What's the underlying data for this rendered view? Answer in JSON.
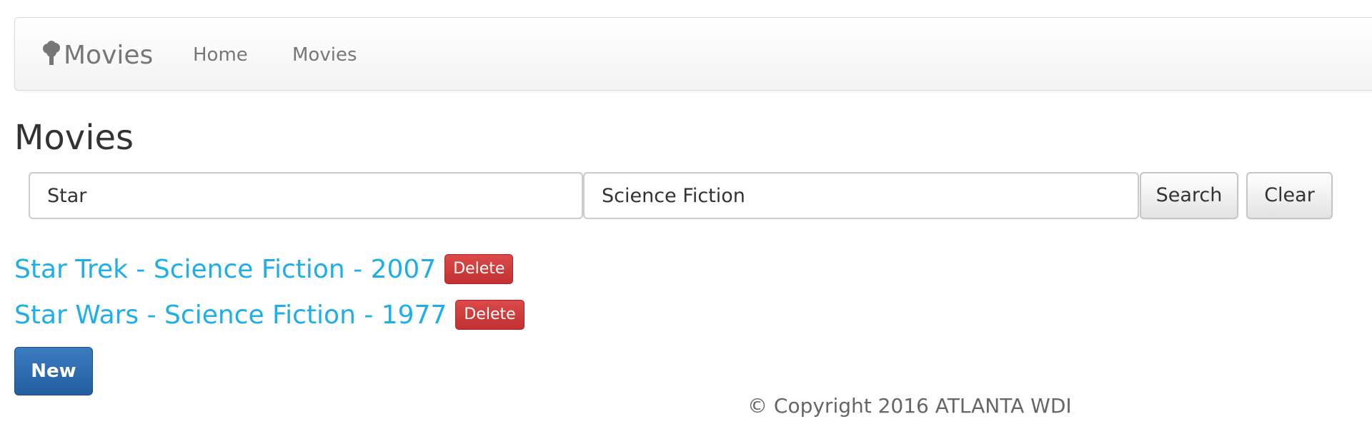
{
  "navbar": {
    "brand_label": "Movies",
    "brand_icon": "tree-icon",
    "links": [
      {
        "label": "Home"
      },
      {
        "label": "Movies"
      }
    ]
  },
  "page": {
    "title": "Movies"
  },
  "search": {
    "title_value": "Star",
    "genre_value": "Science Fiction",
    "search_label": "Search",
    "clear_label": "Clear"
  },
  "movies": [
    {
      "text": "Star Trek - Science Fiction - 2007",
      "delete_label": "Delete"
    },
    {
      "text": "Star Wars - Science Fiction - 1977",
      "delete_label": "Delete"
    }
  ],
  "actions": {
    "new_label": "New"
  },
  "footer": {
    "copyright": "© Copyright 2016 ATLANTA WDI"
  },
  "colors": {
    "link": "#1eaeea",
    "danger": "#c9302c",
    "primary": "#286090",
    "nav_text": "#777777"
  }
}
